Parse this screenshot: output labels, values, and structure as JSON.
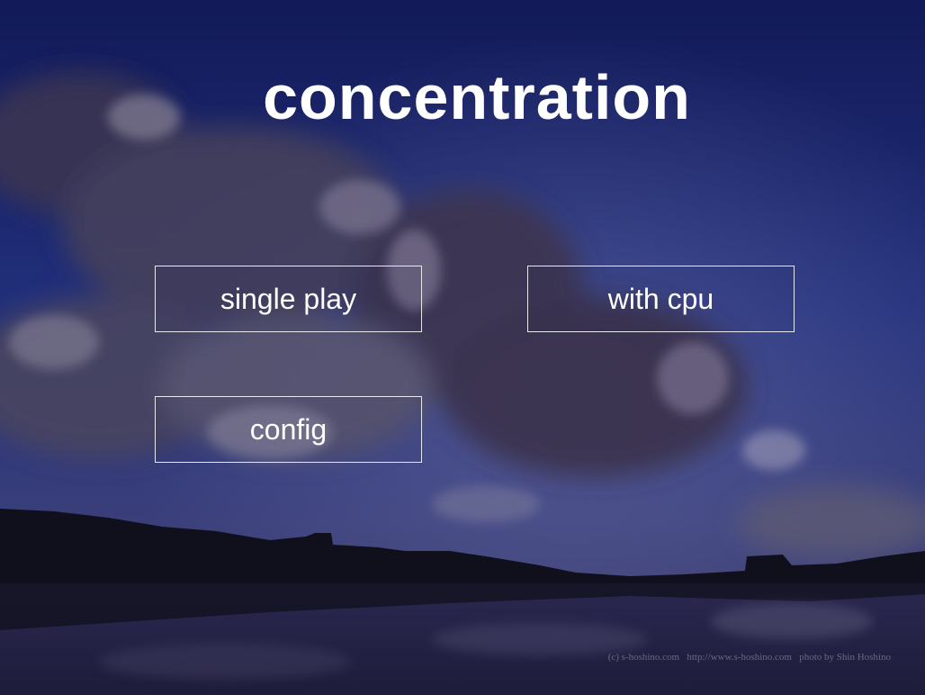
{
  "title": "concentration",
  "menu": {
    "single_play": "single play",
    "with_cpu": "with cpu",
    "config": "config"
  },
  "credit": "(c) s-hoshino.com   http://www.s-hoshino.com   photo by Shin Hoshino",
  "colors": {
    "sky_top": "#141c5c",
    "sky_mid": "#24307a",
    "text": "#ffffff",
    "button_border": "#e8e8f0"
  }
}
